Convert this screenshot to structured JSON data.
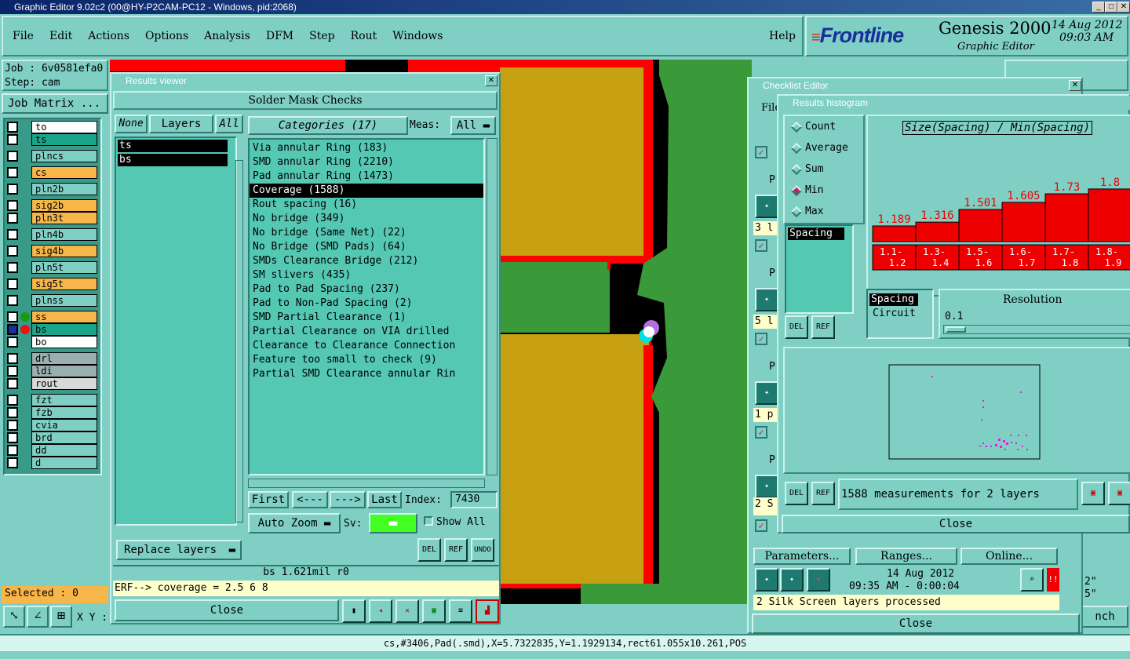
{
  "window": {
    "title": "Graphic Editor 9.02c2 (00@HY-P2CAM-PC12 - Windows, pid:2068)"
  },
  "menu": {
    "items": [
      "File",
      "Edit",
      "Actions",
      "Options",
      "Analysis",
      "DFM",
      "Step",
      "Rout",
      "Windows"
    ],
    "help": "Help"
  },
  "brand": {
    "logo": "Frontline",
    "product": "Genesis 2000",
    "subtitle": "Graphic Editor",
    "date": "14 Aug 2012",
    "time": "09:03 AM"
  },
  "job": {
    "job_label": "Job : 6v0581efa0",
    "step_label": "Step: cam",
    "matrix_button": "Job Matrix ..."
  },
  "layers": [
    {
      "name": "to",
      "color": "#ffffff"
    },
    {
      "name": "ts",
      "color": "#19a58a"
    },
    {
      "name": "plncs",
      "color": "#7fcfc4"
    },
    {
      "name": "cs",
      "color": "#f7b64a"
    },
    {
      "name": "pln2b",
      "color": "#7fcfc4"
    },
    {
      "name": "sig2b",
      "color": "#f7b64a"
    },
    {
      "name": "pln3t",
      "color": "#f7b64a"
    },
    {
      "name": "pln4b",
      "color": "#7fcfc4"
    },
    {
      "name": "sig4b",
      "color": "#f7b64a"
    },
    {
      "name": "pln5t",
      "color": "#7fcfc4"
    },
    {
      "name": "sig5t",
      "color": "#f7b64a"
    },
    {
      "name": "plnss",
      "color": "#7fcfc4"
    },
    {
      "name": "ss",
      "color": "#f7b64a"
    },
    {
      "name": "bs",
      "color": "#19a58a"
    },
    {
      "name": "bo",
      "color": "#ffffff"
    },
    {
      "name": "drl",
      "color": "#9ab0b0"
    },
    {
      "name": "ldi",
      "color": "#9ab0b0"
    },
    {
      "name": "rout",
      "color": "#d8d8d8"
    },
    {
      "name": "fzt",
      "color": "#7fcfc4"
    },
    {
      "name": "fzb",
      "color": "#7fcfc4"
    },
    {
      "name": "cvia",
      "color": "#7fcfc4"
    },
    {
      "name": "brd",
      "color": "#7fcfc4"
    },
    {
      "name": "dd",
      "color": "#7fcfc4"
    },
    {
      "name": "d",
      "color": "#7fcfc4"
    }
  ],
  "status": {
    "selected": "Selected : 0",
    "xy": "X Y :",
    "bottom": "cs,#3406,Pad(.smd),X=5.7322835,Y=1.1929134,rect61.055x10.261,POS"
  },
  "results_viewer": {
    "title": "Results viewer",
    "heading": "Solder Mask Checks",
    "none_btn": "None",
    "layers_btn": "Layers",
    "all_btn": "All",
    "layer_items": [
      "ts",
      "bs"
    ],
    "categories_label": "Categories (17)",
    "meas_label": "Meas:",
    "meas_value": "All",
    "categories": [
      "Via annular Ring (183)",
      "SMD annular Ring (2210)",
      "Pad annular Ring (1473)",
      "Coverage (1588)",
      "Rout spacing (16)",
      "No bridge (349)",
      "No bridge (Same Net) (22)",
      "No Bridge (SMD Pads) (64)",
      "SMDs Clearance Bridge (212)",
      "SM slivers (435)",
      "Pad to Pad Spacing (237)",
      "Pad to Non-Pad Spacing (2)",
      "SMD Partial Clearance (1)",
      "Partial Clearance on VIA drilled",
      "Clearance to Clearance Connection",
      "Feature too small to check (9)",
      "Partial SMD Clearance annular Rin"
    ],
    "selected_category": 3,
    "first": "First",
    "prev": "<---",
    "next": "--->",
    "last": "Last",
    "index_label": "Index:",
    "index_value": "7430",
    "auto_zoom": "Auto Zoom",
    "sv_label": "Sv:",
    "show_all": "Show All",
    "replace_layers": "Replace layers",
    "info": "bs 1.621mil  r0",
    "erf": "ERF--> coverage = 2.5 6 8",
    "close": "Close",
    "del": "DEL",
    "ref": "REF",
    "undo": "UNDO"
  },
  "checklist": {
    "title": "Checklist Editor",
    "file_menu": "File",
    "rows": [
      "3 l",
      "5 l",
      "1 p",
      "2 S",
      "2 S"
    ],
    "p_label": "P",
    "parameters": "Parameters...",
    "ranges": "Ranges...",
    "online": "Online...",
    "date": "14 Aug 2012",
    "time": "09:35 AM - 0:00:04",
    "status": "2 Silk Screen layers processed",
    "close": "Close",
    "side_values": [
      "2\"",
      "5\""
    ],
    "side_button": "nch"
  },
  "histogram": {
    "title": "Results histogram",
    "modes": [
      "Count",
      "Average",
      "Sum",
      "Min",
      "Max"
    ],
    "selected_mode": "Min",
    "chart_title": "Size(Spacing) / Min(Spacing)",
    "list1": [
      "Spacing"
    ],
    "list2": [
      "Spacing",
      "Circuit"
    ],
    "resolution_label": "Resolution",
    "resolution_value": "0.1",
    "measurements": "1588 measurements for 2 layers",
    "close": "Close",
    "del": "DEL",
    "ref": "REF"
  },
  "chart_data": {
    "type": "bar",
    "title": "Size(Spacing) / Min(Spacing)",
    "categories": [
      "1.1-1.2",
      "1.3-1.4",
      "1.5-1.6",
      "1.6-1.7",
      "1.7-1.8",
      "1.8-1.9"
    ],
    "category_labels_top": [
      "1.1-",
      "1.3-",
      "1.5-",
      "1.6-",
      "1.7-",
      "1.8-"
    ],
    "category_labels_bottom": [
      "1.2",
      "1.4",
      "1.6",
      "1.7",
      "1.8",
      "1.9"
    ],
    "values": [
      1.189,
      1.316,
      1.501,
      1.605,
      1.73,
      1.8
    ],
    "value_labels": [
      "1.189",
      "1.316",
      "1.501",
      "1.605",
      "1.73",
      "1.8"
    ],
    "ylim": [
      0,
      2.2
    ],
    "bar_color": "#ee0000"
  }
}
